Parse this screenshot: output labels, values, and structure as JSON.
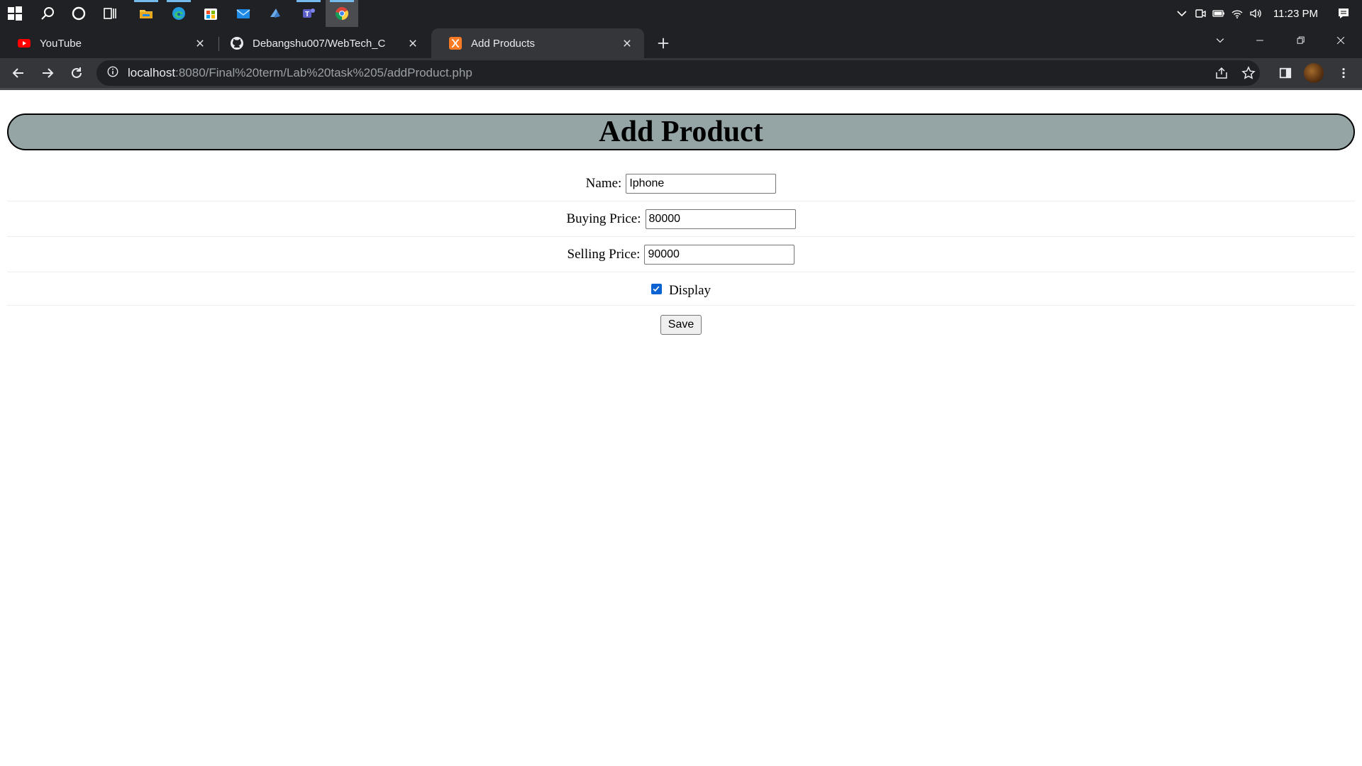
{
  "taskbar": {
    "clock": "11:23 PM"
  },
  "tabs": [
    {
      "title": "YouTube",
      "icon": "youtube-icon"
    },
    {
      "title": "Debangshu007/WebTech_C",
      "icon": "github-icon"
    },
    {
      "title": "Add Products",
      "icon": "xampp-icon"
    }
  ],
  "omnibox": {
    "host": "localhost",
    "path": ":8080/Final%20term/Lab%20task%205/addProduct.php"
  },
  "page": {
    "heading": "Add Product",
    "name_label": "Name:",
    "name_value": "Iphone",
    "buying_label": "Buying Price:",
    "buying_value": "80000",
    "selling_label": "Selling Price:",
    "selling_value": "90000",
    "display_label": "Display",
    "display_checked": true,
    "save_label": "Save"
  },
  "colors": {
    "header_bg": "#95a5a6",
    "chrome_dark": "#202124",
    "chrome_toolbar": "#35363a",
    "checkbox_accent": "#0b63d1"
  }
}
